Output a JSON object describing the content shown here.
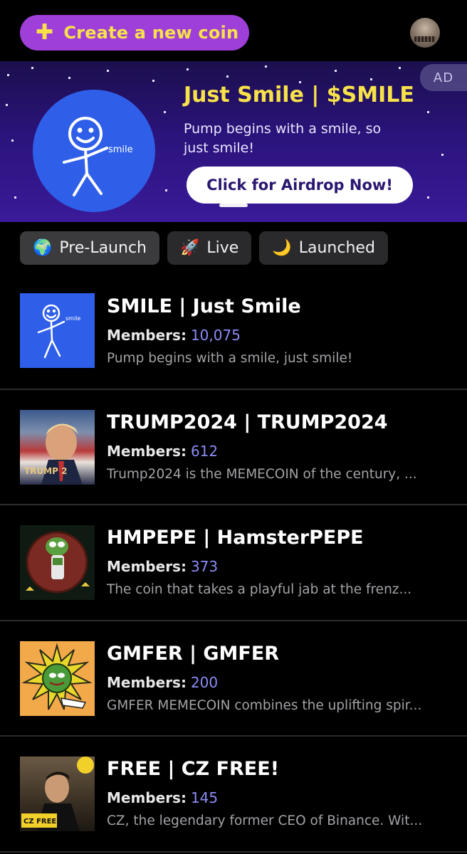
{
  "header": {
    "create_label": "Create a new coin",
    "create_icon": "plus-icon",
    "accent_purple": "#9e3fd9",
    "accent_yellow": "#f8e24a"
  },
  "ad": {
    "badge": "AD",
    "title": "Just Smile | $SMILE",
    "description": "Pump begins with a smile, so just smile!",
    "cta": "Click for Airdrop Now!",
    "logo_text": "smile"
  },
  "tabs": [
    {
      "emoji": "🌍",
      "label": "Pre-Launch"
    },
    {
      "emoji": "🚀",
      "label": "Live"
    },
    {
      "emoji": "🌙",
      "label": "Launched"
    }
  ],
  "members_label": "Members:",
  "coins": [
    {
      "name": "SMILE | Just Smile",
      "members": "10,075",
      "description": "Pump begins with a smile, just smile!",
      "thumb_text": "smile"
    },
    {
      "name": "TRUMP2024 | TRUMP2024",
      "members": "612",
      "description": "Trump2024 is the MEMECOIN of the century, ...",
      "thumb_text": "TRUMP 2"
    },
    {
      "name": "HMPEPE | HamsterPEPE",
      "members": "373",
      "description": "The coin that takes a playful jab at the frenz...",
      "thumb_text": ""
    },
    {
      "name": "GMFER | GMFER",
      "members": "200",
      "description": "GMFER MEMECOIN combines the uplifting spir...",
      "thumb_text": ""
    },
    {
      "name": "FREE | CZ FREE!",
      "members": "145",
      "description": "CZ, the legendary former CEO of Binance. Wit...",
      "thumb_text": "CZ FREE !"
    }
  ]
}
